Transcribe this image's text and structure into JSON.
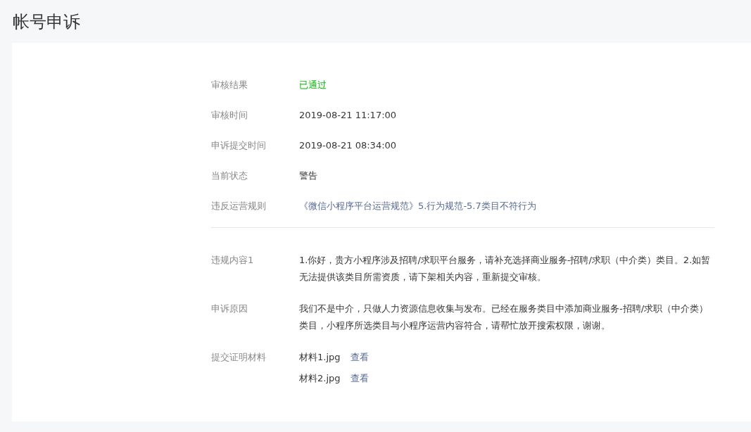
{
  "page_title": "帐号申诉",
  "review": [
    {
      "label": "审核结果",
      "value": "已通过",
      "kind": "status"
    },
    {
      "label": "审核时间",
      "value": "2019-08-21 11:17:00",
      "kind": "text"
    },
    {
      "label": "申诉提交时间",
      "value": "2019-08-21 08:34:00",
      "kind": "text"
    },
    {
      "label": "当前状态",
      "value": "警告",
      "kind": "text"
    },
    {
      "label": "违反运营规则",
      "value": "《微信小程序平台运营规范》5.行为规范-5.7类目不符行为",
      "kind": "link"
    }
  ],
  "appeal": [
    {
      "label": "违规内容1",
      "value": "1.你好，贵方小程序涉及招聘/求职平台服务，请补充选择商业服务-招聘/求职（中介类）类目。2.如暂无法提供该类目所需资质，请下架相关内容，重新提交审核。"
    },
    {
      "label": "申诉原因",
      "value": "我们不是中介，只做人力资源信息收集与发布。已经在服务类目中添加商业服务-招聘/求职（中介类）类目，小程序所选类目与小程序运营内容符合，请帮忙放开搜索权限，谢谢。"
    }
  ],
  "materials": {
    "label": "提交证明材料",
    "files": [
      {
        "name": "材料1.jpg",
        "action": "查看"
      },
      {
        "name": "材料2.jpg",
        "action": "查看"
      }
    ]
  }
}
